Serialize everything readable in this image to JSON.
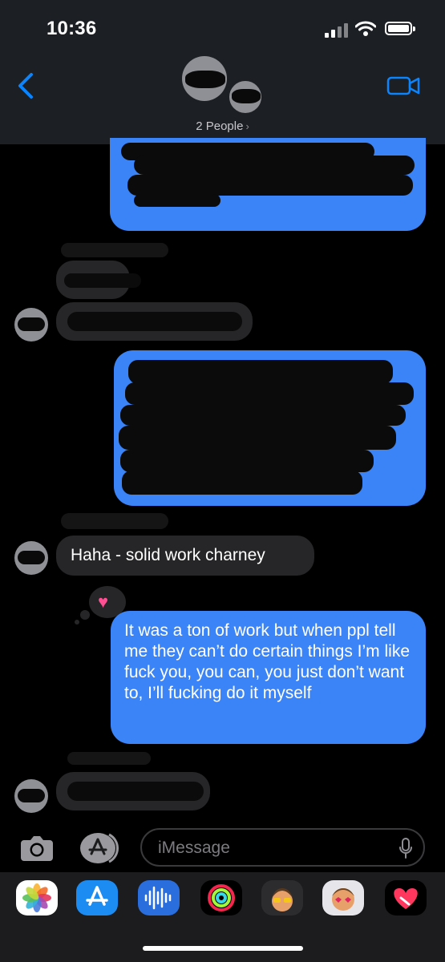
{
  "status_bar": {
    "time": "10:36"
  },
  "header": {
    "people_label": "2 People",
    "chevron": "›"
  },
  "messages": {
    "received_1": "Haha - solid work charney",
    "sent_2": "It was a ton of work but when ppl tell me they can’t do certain things I’m like fuck you, you can, you just don’t want to, I’ll fucking do it myself"
  },
  "compose": {
    "placeholder": "iMessage"
  },
  "colors": {
    "sent_bubble": "#3b84f7",
    "received_bubble": "#262628",
    "accent": "#0a84ff",
    "tapback_heart": "#ff4f93"
  },
  "icons": {
    "back": "chevron-left-icon",
    "video": "video-camera-icon",
    "camera": "camera-icon",
    "apps": "app-store-icon",
    "mic": "microphone-icon",
    "tapback": "heart-icon"
  },
  "app_drawer": [
    "Photos",
    "App Store",
    "Audio",
    "Activity",
    "Memoji",
    "Memoji Stickers",
    "Digital Touch"
  ]
}
